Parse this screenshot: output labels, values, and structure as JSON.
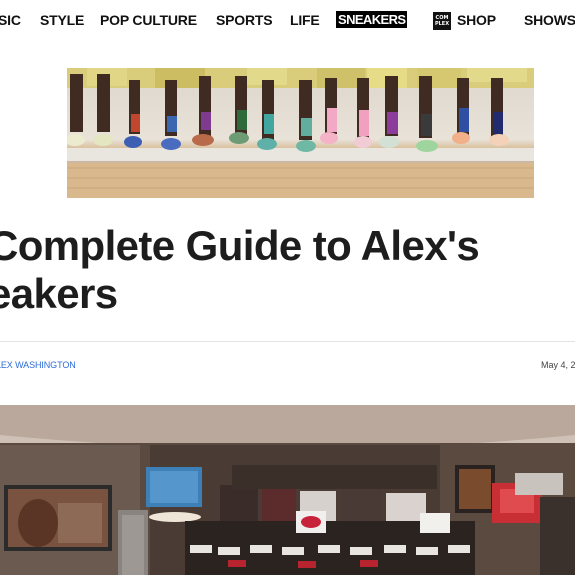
{
  "nav": {
    "items": [
      {
        "label": "SIC",
        "active": false
      },
      {
        "label": "STYLE",
        "active": false
      },
      {
        "label": "POP CULTURE",
        "active": false
      },
      {
        "label": "SPORTS",
        "active": false
      },
      {
        "label": "LIFE",
        "active": false
      },
      {
        "label": "SNEAKERS",
        "active": true
      },
      {
        "label": "SHOP",
        "active": false
      },
      {
        "label": "SHOWS",
        "active": false
      }
    ],
    "shop_logo_text": "COM PLEX"
  },
  "hero": {
    "icon": "sneakers-photo"
  },
  "article": {
    "headline_line1": "Complete Guide to Alex's",
    "headline_line2": "eakers",
    "byline": "LEX WASHINGTON",
    "date": "May 4, 2"
  },
  "room": {
    "icon": "sneaker-room-photo"
  },
  "colors": {
    "accent_link": "#2c6bd6",
    "nav_active_bg": "#000000",
    "text": "#1d1d1d"
  }
}
